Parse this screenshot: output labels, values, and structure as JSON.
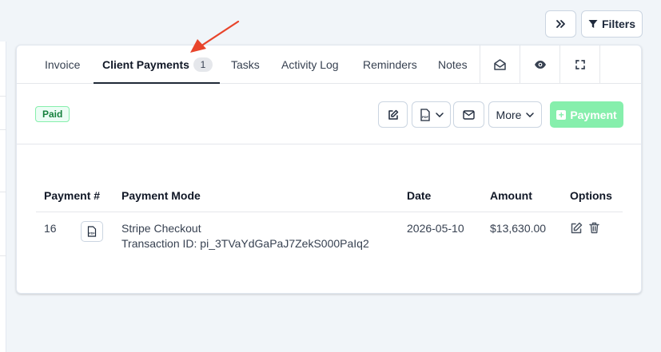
{
  "top_bar": {
    "expand_icon": "double-chevron-right-icon",
    "filters_icon": "funnel-icon",
    "filters_label": "Filters"
  },
  "tabs": {
    "invoice": "Invoice",
    "client_payments": "Client Payments",
    "client_payments_count": "1",
    "tasks": "Tasks",
    "activity_log": "Activity Log",
    "reminders": "Reminders",
    "notes": "Notes",
    "icons": [
      "envelope-open-icon",
      "eye-icon",
      "expand-icon"
    ]
  },
  "toolbar": {
    "status": "Paid",
    "more_label": "More",
    "payment_label": "Payment",
    "icons": [
      "edit-icon",
      "pdf-icon",
      "chevron-down-icon",
      "envelope-icon"
    ]
  },
  "table": {
    "headers": {
      "payment_no": "Payment #",
      "payment_mode": "Payment Mode",
      "date": "Date",
      "amount": "Amount",
      "options": "Options"
    },
    "rows": [
      {
        "payment_no": "16",
        "payment_mode": "Stripe Checkout",
        "transaction": "Transaction ID: pi_3TVaYdGaPaJ7ZekS000PaIq2",
        "date": "2026-05-10",
        "amount": "$13,630.00"
      }
    ]
  },
  "colors": {
    "accent_green": "#86efac",
    "paid_text": "#15803d",
    "annotation_arrow": "#e8442b"
  }
}
